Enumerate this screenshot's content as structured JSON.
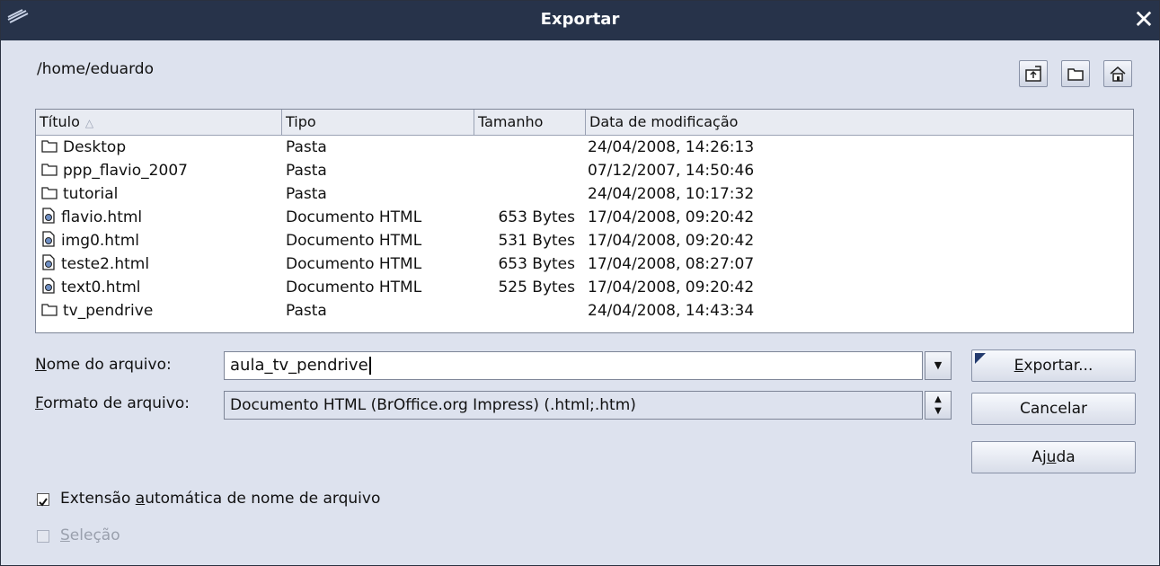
{
  "window": {
    "title": "Exportar"
  },
  "path": "/home/eduardo",
  "columns": [
    "Título",
    "Tipo",
    "Tamanho",
    "Data de modificação"
  ],
  "files": [
    {
      "name": "Desktop",
      "type": "Pasta",
      "size": "",
      "date": "24/04/2008, 14:26:13",
      "icon": "folder-icon"
    },
    {
      "name": "ppp_flavio_2007",
      "type": "Pasta",
      "size": "",
      "date": "07/12/2007, 14:50:46",
      "icon": "folder-icon"
    },
    {
      "name": "tutorial",
      "type": "Pasta",
      "size": "",
      "date": "24/04/2008, 10:17:32",
      "icon": "folder-icon"
    },
    {
      "name": "flavio.html",
      "type": "Documento HTML",
      "size": "653 Bytes",
      "date": "17/04/2008, 09:20:42",
      "icon": "html-file-icon"
    },
    {
      "name": "img0.html",
      "type": "Documento HTML",
      "size": "531 Bytes",
      "date": "17/04/2008, 09:20:42",
      "icon": "html-file-icon"
    },
    {
      "name": "teste2.html",
      "type": "Documento HTML",
      "size": "653 Bytes",
      "date": "17/04/2008, 08:27:07",
      "icon": "html-file-icon"
    },
    {
      "name": "text0.html",
      "type": "Documento HTML",
      "size": "525 Bytes",
      "date": "17/04/2008, 09:20:42",
      "icon": "html-file-icon"
    },
    {
      "name": "tv_pendrive",
      "type": "Pasta",
      "size": "",
      "date": "24/04/2008, 14:43:34",
      "icon": "folder-icon"
    }
  ],
  "filename": {
    "label_prefix": "N",
    "label_rest": "ome do arquivo:",
    "value": "aula_tv_pendrive"
  },
  "format": {
    "label_prefix": "F",
    "label_rest": "ormato de arquivo:",
    "value": "Documento HTML (BrOffice.org Impress) (.html;.htm)"
  },
  "buttons": {
    "export_prefix": "E",
    "export_rest": "xportar...",
    "cancel": "Cancelar",
    "help_pre": "Aj",
    "help_u": "u",
    "help_post": "da"
  },
  "options": {
    "auto_ext_pre": "Extensão ",
    "auto_ext_u": "a",
    "auto_ext_post": "utomática de nome de arquivo",
    "auto_ext_checked": true,
    "selection_u": "S",
    "selection_post": "eleção",
    "selection_checked": false
  },
  "colors": {
    "titlebar": "#27334a",
    "dialog_bg": "#dde2ee",
    "default_mark": "#233a6e"
  }
}
